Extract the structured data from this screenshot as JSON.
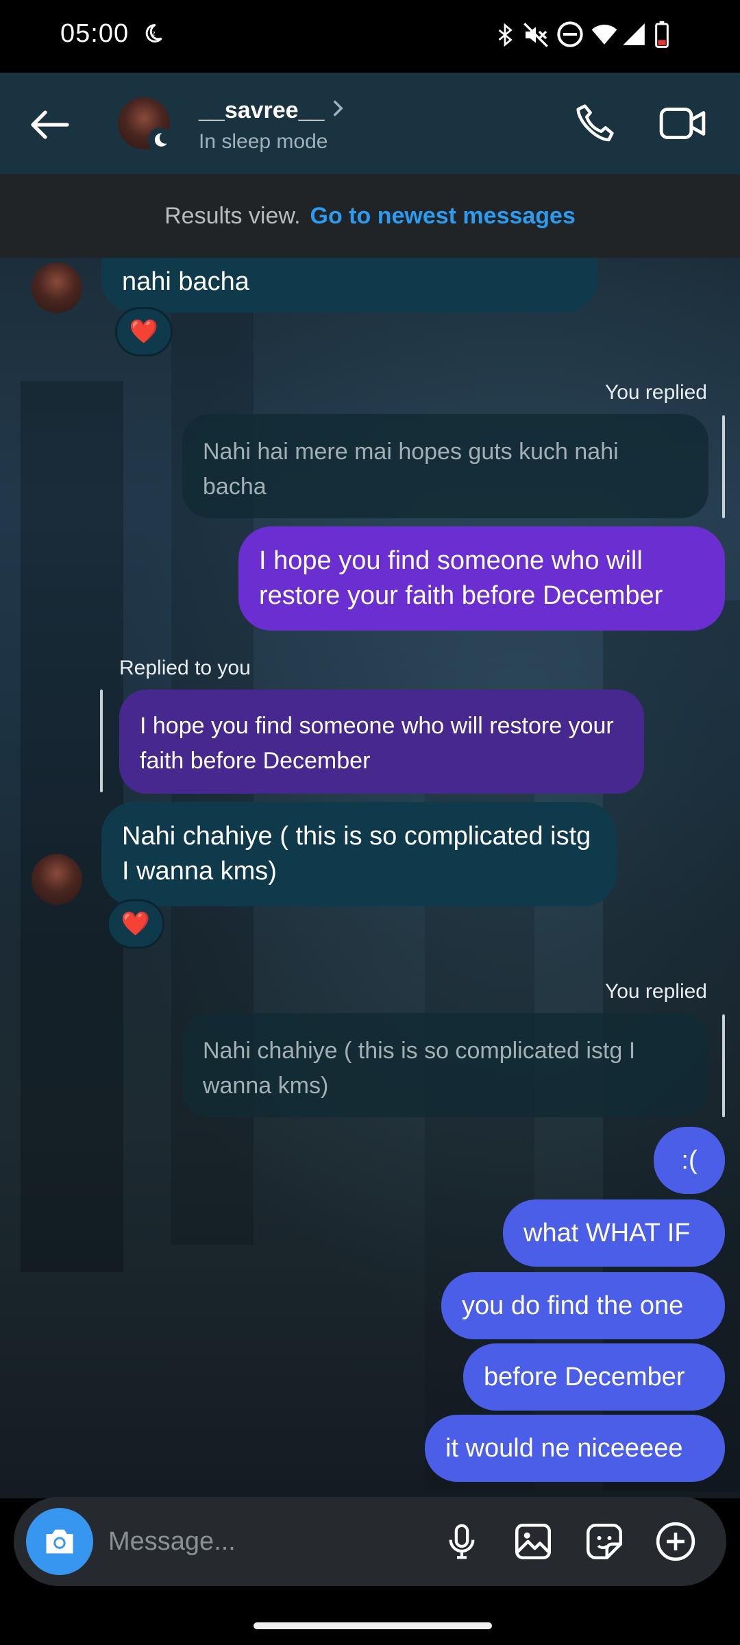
{
  "status_bar": {
    "time": "05:00"
  },
  "header": {
    "contact_name": "__savree__",
    "contact_status": "In sleep mode"
  },
  "results_bar": {
    "label": "Results view.",
    "link": "Go to newest messages"
  },
  "messages": {
    "m1_text": "nahi bacha",
    "m1_reaction": "❤️",
    "m2_meta": "You replied",
    "m2_quote": "Nahi hai mere mai hopes guts kuch nahi bacha",
    "m2_text": "I hope you find someone who will restore your faith before December",
    "m3_meta": "Replied to you",
    "m3_quote": "I hope you find someone who will restore your faith before December",
    "m3_text": "Nahi chahiye ( this is so complicated istg I wanna kms)",
    "m3_reaction": "❤️",
    "m4_meta": "You replied",
    "m4_quote": "Nahi chahiye ( this is so complicated istg I wanna kms)",
    "m5_text": ":(",
    "m6_text": "what WHAT IF",
    "m7_text": "you do find the one",
    "m8_text": "before December",
    "m9_text": "it would ne niceeeee"
  },
  "composer": {
    "placeholder": "Message..."
  },
  "colors": {
    "header_bg": "#1a3340",
    "received_bubble": "#0f3a4c",
    "sent_purple": "#6b2ed0",
    "sent_blue": "#4a5ee8",
    "link_blue": "#2d9bf0",
    "camera_blue": "#3797f0"
  },
  "icons": {
    "status": [
      "moon-icon",
      "bluetooth-icon",
      "mute-icon",
      "dnd-icon",
      "wifi-icon",
      "signal-icon",
      "battery-icon"
    ],
    "header": [
      "back-arrow-icon",
      "chevron-right-icon",
      "phone-icon",
      "video-camera-icon"
    ],
    "composer": [
      "camera-icon",
      "microphone-icon",
      "gallery-icon",
      "sticker-icon",
      "plus-circle-icon"
    ]
  }
}
